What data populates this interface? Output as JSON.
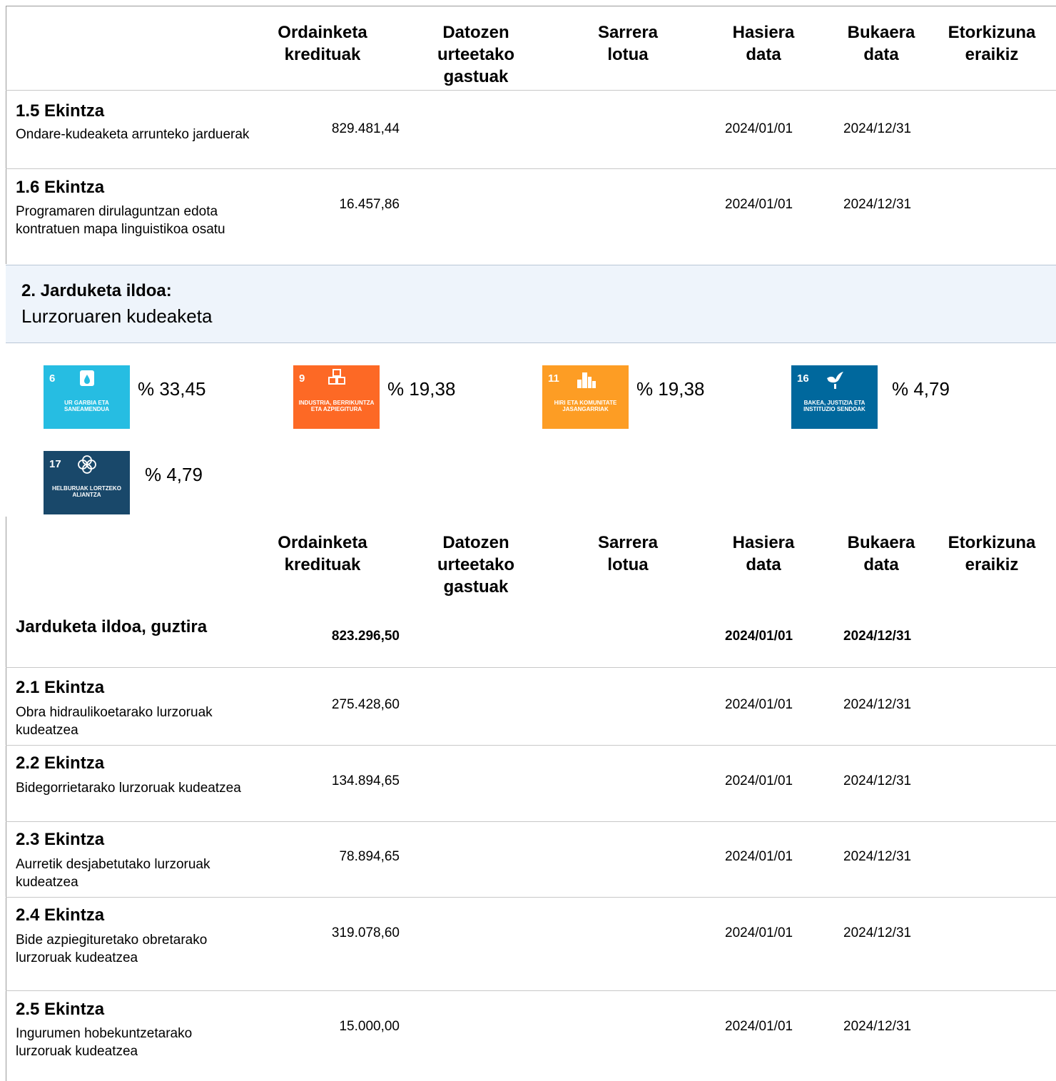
{
  "header": {
    "ordainketa": "Ordainketa\nkredituak",
    "datozen": "Datozen\nurteetako\ngastuak",
    "sarrera": "Sarrera\nlotua",
    "hasiera": "Hasiera\ndata",
    "bukaera": "Bukaera\ndata",
    "etorkizuna": "Etorkizuna\neraikiz"
  },
  "rows1": [
    {
      "title": "1.5 Ekintza",
      "desc": "Ondare-kudeaketa arrunteko jarduerak",
      "amount": "829.481,44",
      "start": "2024/01/01",
      "end": "2024/12/31"
    },
    {
      "title": "1.6 Ekintza",
      "desc": "Programaren dirulaguntzan edota kontratuen mapa linguistikoa osatu",
      "amount": "16.457,86",
      "start": "2024/01/01",
      "end": "2024/12/31"
    }
  ],
  "band": {
    "title": "2. Jarduketa ildoa:",
    "subtitle": "Lurzoruaren kudeaketa"
  },
  "sdgs": [
    {
      "num": "6",
      "label": "UR GARBIA ETA SANEAMENDUA",
      "color": "#26bde2",
      "icon": "water-drop-icon",
      "pct": "% 33,45"
    },
    {
      "num": "9",
      "label": "INDUSTRIA, BERRIKUNTZA ETA AZPIEGITURA",
      "color": "#fd6925",
      "icon": "cubes-icon",
      "pct": "% 19,38"
    },
    {
      "num": "11",
      "label": "HIRI ETA KOMUNITATE JASANGARRIAK",
      "color": "#fd9d24",
      "icon": "city-icon",
      "pct": "% 19,38"
    },
    {
      "num": "16",
      "label": "BAKEA, JUSTIZIA ETA INSTITUZIO SENDOAK",
      "color": "#00689d",
      "icon": "dove-icon",
      "pct": "% 4,79"
    },
    {
      "num": "17",
      "label": "HELBURUAK LORTZEKO ALIANTZA",
      "color": "#19486a",
      "icon": "flower-ring-icon",
      "pct": "% 4,79"
    }
  ],
  "total": {
    "title": "Jarduketa ildoa, guztira",
    "amount": "823.296,50",
    "start": "2024/01/01",
    "end": "2024/12/31"
  },
  "rows2": [
    {
      "title": "2.1 Ekintza",
      "desc": "Obra hidraulikoetarako lurzoruak kudeatzea",
      "amount": "275.428,60",
      "start": "2024/01/01",
      "end": "2024/12/31"
    },
    {
      "title": "2.2 Ekintza",
      "desc": "Bidegorrietarako lurzoruak kudeatzea",
      "amount": "134.894,65",
      "start": "2024/01/01",
      "end": "2024/12/31"
    },
    {
      "title": "2.3 Ekintza",
      "desc": "Aurretik desjabetutako lurzoruak kudeatzea",
      "amount": "78.894,65",
      "start": "2024/01/01",
      "end": "2024/12/31"
    },
    {
      "title": "2.4 Ekintza",
      "desc": "Bide azpiegituretako obretarako lurzoruak kudeatzea",
      "amount": "319.078,60",
      "start": "2024/01/01",
      "end": "2024/12/31"
    },
    {
      "title": "2.5 Ekintza",
      "desc": "Ingurumen hobekuntzetarako lurzoruak kudeatzea",
      "amount": "15.000,00",
      "start": "2024/01/01",
      "end": "2024/12/31"
    }
  ]
}
